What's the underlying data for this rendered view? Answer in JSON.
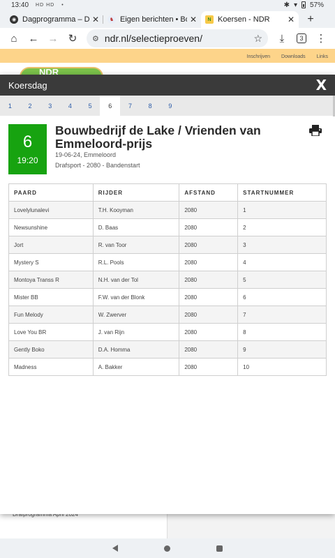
{
  "status": {
    "time": "13:40",
    "network": "HD HD",
    "dot": "•",
    "battery": "57%"
  },
  "browser": {
    "tabs": [
      {
        "title": "Dagprogramma – Dra",
        "close": "✕"
      },
      {
        "title": "Eigen berichten • Bokt",
        "close": "✕"
      },
      {
        "title": "Koersen - NDR",
        "close": "✕"
      }
    ],
    "new_tab": "+",
    "url": "ndr.nl/selectieproeven/",
    "tab_count": "3"
  },
  "background": {
    "top_links": [
      "Inschrijven",
      "Downloads",
      "Links"
    ],
    "logo": "NDR",
    "bottom_text": "Drafprogramma April 2024"
  },
  "modal": {
    "title": "Koersdag",
    "close_label": "X",
    "race_tabs": [
      "1",
      "2",
      "3",
      "4",
      "5",
      "6",
      "7",
      "8",
      "9"
    ],
    "active_tab": "6",
    "race_number": "6",
    "race_time": "19:20",
    "race_title": "Bouwbedrijf de Lake / Vrienden van Emmeloord-prijs",
    "race_date": "19-06-24, Emmeloord",
    "race_info": "Drafsport - 2080 - Bandenstart",
    "table": {
      "headers": [
        "PAARD",
        "RIJDER",
        "AFSTAND",
        "STARTNUMMER"
      ],
      "rows": [
        [
          "Lovelylunalevi",
          "T.H. Kooyman",
          "2080",
          "1"
        ],
        [
          "Newsunshine",
          "D. Baas",
          "2080",
          "2"
        ],
        [
          "Jort",
          "R. van Toor",
          "2080",
          "3"
        ],
        [
          "Mystery S",
          "R.L. Pools",
          "2080",
          "4"
        ],
        [
          "Montoya Transs R",
          "N.H. van der Tol",
          "2080",
          "5"
        ],
        [
          "Mister BB",
          "F.W. van der Blonk",
          "2080",
          "6"
        ],
        [
          "Fun Melody",
          "W. Zwerver",
          "2080",
          "7"
        ],
        [
          "Love You BR",
          "J. van Rijn",
          "2080",
          "8"
        ],
        [
          "Gently Boko",
          "D.A. Homma",
          "2080",
          "9"
        ],
        [
          "Madness",
          "A. Bakker",
          "2080",
          "10"
        ]
      ]
    }
  },
  "colors": {
    "badge": "#17a310",
    "header": "#3a3a3a",
    "link": "#2a5ba8",
    "banner": "#fdd48a"
  }
}
